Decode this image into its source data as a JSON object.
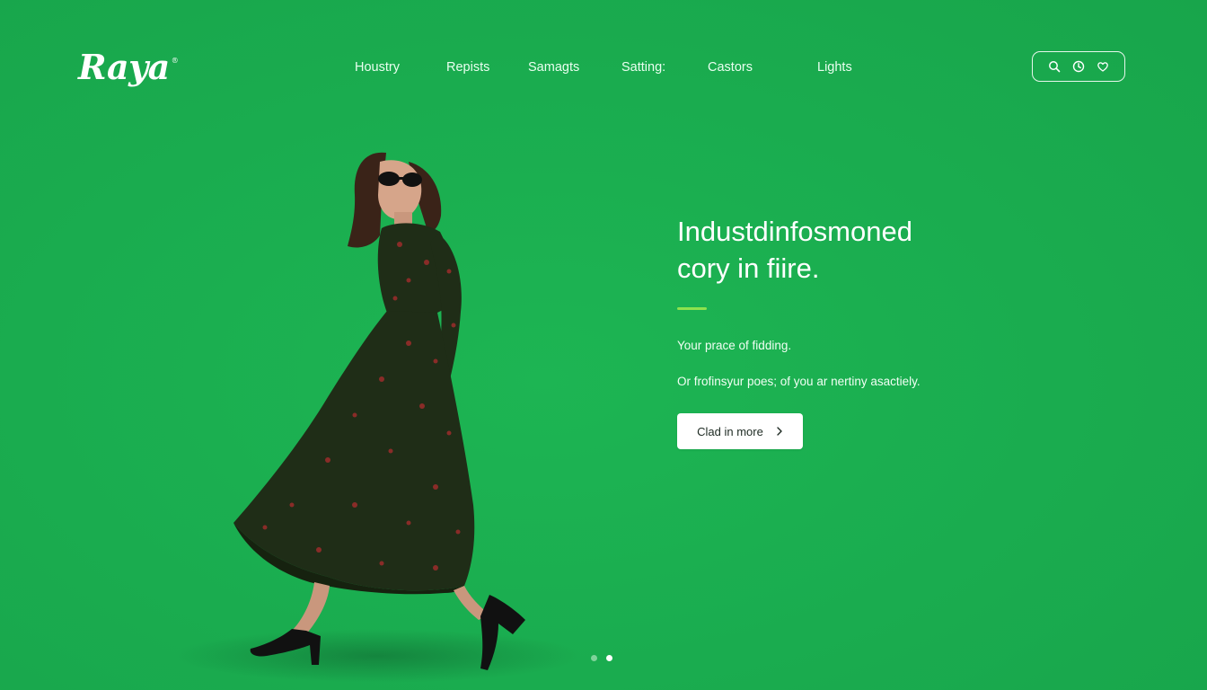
{
  "brand": {
    "name": "Raya",
    "mark": "®"
  },
  "nav": {
    "items": [
      {
        "label": "Houstry"
      },
      {
        "label": "Repists"
      },
      {
        "label": "Samagts"
      },
      {
        "label": "Satting:"
      },
      {
        "label": "Castors"
      },
      {
        "label": "Lights"
      }
    ]
  },
  "utility_icons": [
    "search-icon",
    "clock-icon",
    "heart-icon"
  ],
  "hero": {
    "headline_line1": "Industdinfosmoned",
    "headline_line2": "cory in fiire.",
    "tagline": "Your prace of fidding.",
    "description": "Or frofinsyur poes; of you ar nertiny asactiely.",
    "cta_label": "Clad in more",
    "cta_icon": "chevron-right-icon"
  },
  "carousel": {
    "slides": 2,
    "active_index": 1
  },
  "colors": {
    "background": "#1aac4f",
    "accent": "#8ee24e",
    "dress": "#1f2d17",
    "dot_active": "#ffffff",
    "dot_inactive": "#7fd39a"
  }
}
